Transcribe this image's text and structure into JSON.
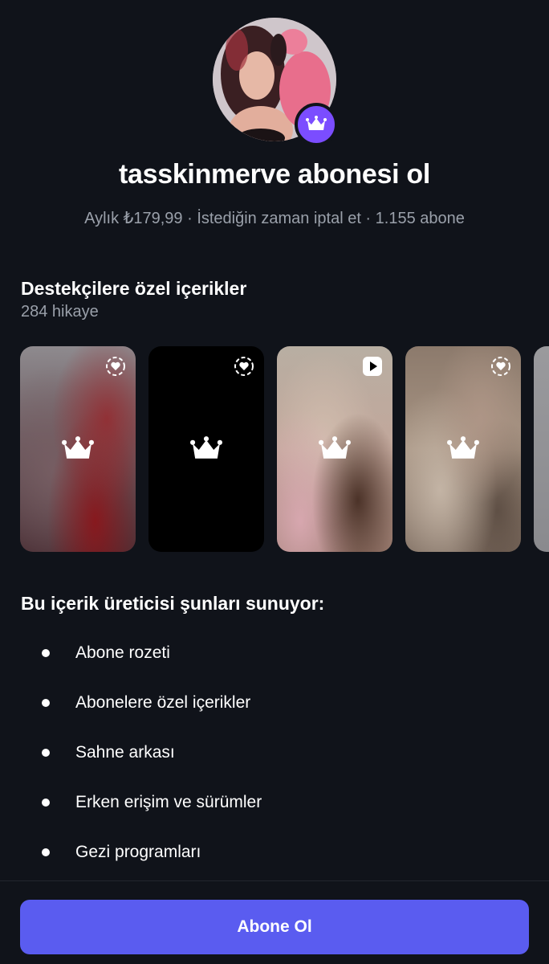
{
  "profile": {
    "title": "tasskinmerve abonesi ol",
    "subtitle": "Aylık ₺179,99 · İstediğin zaman iptal et · 1.155 abone"
  },
  "exclusive": {
    "title": "Destekçilere özel içerikler",
    "count_label": "284 hikaye",
    "stories": [
      {
        "type_icon": "heart-ring-icon"
      },
      {
        "type_icon": "heart-ring-icon"
      },
      {
        "type_icon": "play-icon"
      },
      {
        "type_icon": "heart-ring-icon"
      },
      {
        "type_icon": ""
      }
    ]
  },
  "offers": {
    "title": "Bu içerik üreticisi şunları sunuyor:",
    "items": [
      "Abone rozeti",
      "Abonelere özel içerikler",
      "Sahne arkası",
      "Erken erişim ve sürümler",
      "Gezi programları"
    ]
  },
  "cta": {
    "label": "Abone Ol"
  },
  "colors": {
    "background": "#10131a",
    "accent_badge": "#7b4dff",
    "button": "#5a5cf0",
    "muted_text": "#9aa0aa"
  }
}
